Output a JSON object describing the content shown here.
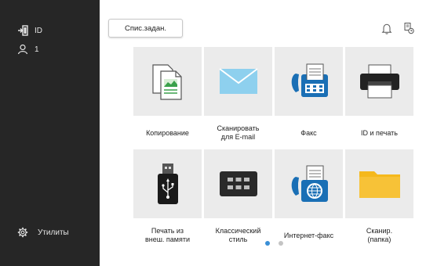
{
  "sidebar": {
    "login_label": "ID",
    "user_label": "1",
    "utilities_label": "Утилиты"
  },
  "header": {
    "job_list_label": "Спис.задан."
  },
  "tiles": [
    {
      "label": "Копирование",
      "icon": "copy-icon"
    },
    {
      "label": "Сканировать\nдля E-mail",
      "icon": "email-envelope-icon"
    },
    {
      "label": "Факс",
      "icon": "fax-icon"
    },
    {
      "label": "ID и печать",
      "icon": "printer-icon"
    },
    {
      "label": "Печать из\nвнеш. памяти",
      "icon": "usb-memory-icon"
    },
    {
      "label": "Классический\nстиль",
      "icon": "keypad-icon"
    },
    {
      "label": "Интернет-факс",
      "icon": "internet-fax-icon"
    },
    {
      "label": "Сканир.\n(папка)",
      "icon": "folder-icon"
    }
  ],
  "pagination": {
    "count": 2,
    "active": 1
  },
  "colors": {
    "sidebar_bg": "#262626",
    "tile_bg": "#ebebeb",
    "accent_blue": "#1a6fb5",
    "folder_yellow": "#f5b81c",
    "dot_active": "#3a8fd6",
    "dot_inactive": "#c4c4c4"
  }
}
